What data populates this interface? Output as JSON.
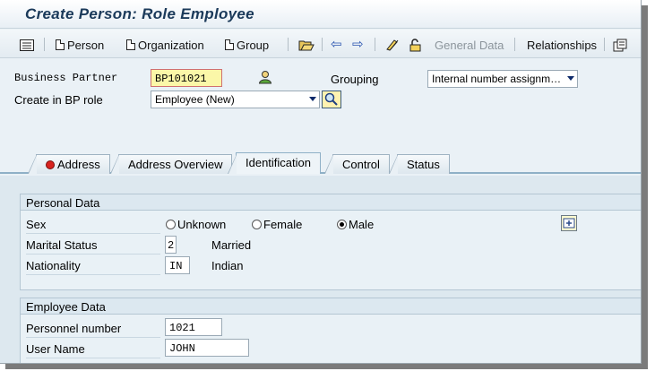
{
  "window": {
    "title": "Create Person: Role Employee"
  },
  "toolbar": {
    "person": "Person",
    "organization": "Organization",
    "group": "Group",
    "general_data": "General Data",
    "relationships": "Relationships"
  },
  "header": {
    "bp_label": "Business Partner",
    "bp_value": "BP101021",
    "grouping_label": "Grouping",
    "grouping_value": "Internal number assignm…",
    "role_label": "Create in BP role",
    "role_value": "Employee (New)"
  },
  "tabs": [
    {
      "label": "Address"
    },
    {
      "label": "Address Overview"
    },
    {
      "label": "Identification"
    },
    {
      "label": "Control"
    },
    {
      "label": "Status"
    }
  ],
  "personal": {
    "title": "Personal Data",
    "sex_label": "Sex",
    "sex_options": [
      "Unknown",
      "Female",
      "Male"
    ],
    "sex_selected": "Male",
    "marital_label": "Marital Status",
    "marital_code": "2",
    "marital_text": "Married",
    "nationality_label": "Nationality",
    "nationality_code": "IN",
    "nationality_text": "Indian"
  },
  "employee": {
    "title": "Employee Data",
    "personnel_label": "Personnel number",
    "personnel_value": "1021",
    "username_label": "User Name",
    "username_value": "JOHN"
  },
  "colors": {
    "title_text": "#1b3a5a",
    "required_field": "#fbf7a8",
    "active_tab": "#eef4f8"
  }
}
